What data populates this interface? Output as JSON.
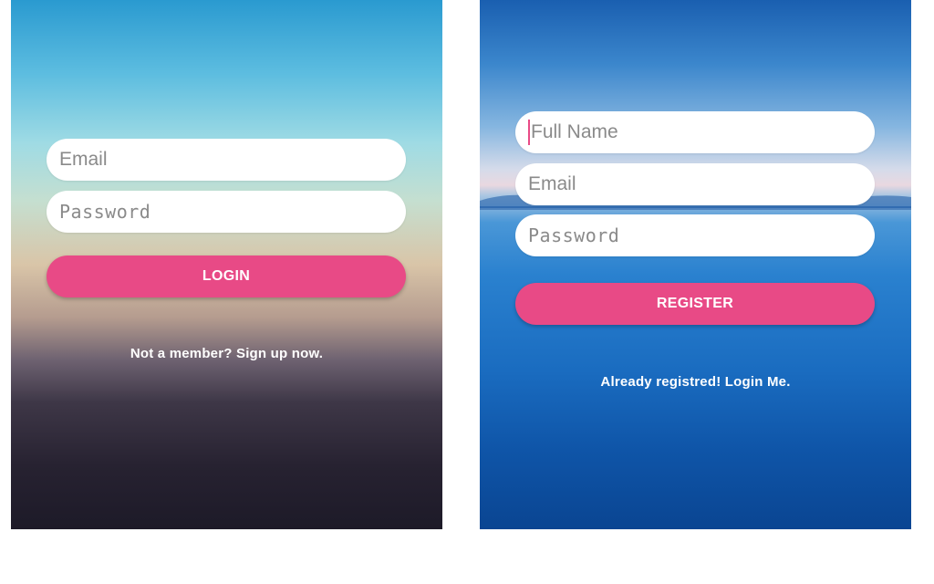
{
  "login": {
    "email_placeholder": "Email",
    "password_placeholder": "Password",
    "button_label": "LOGIN",
    "signup_link": "Not a member? Sign up now."
  },
  "register": {
    "fullname_placeholder": "Full Name",
    "email_placeholder": "Email",
    "password_placeholder": "Password",
    "button_label": "REGISTER",
    "login_link": "Already registred! Login Me."
  },
  "colors": {
    "accent": "#e84a86",
    "field_bg": "#ffffff",
    "placeholder": "#8a8a8a"
  }
}
